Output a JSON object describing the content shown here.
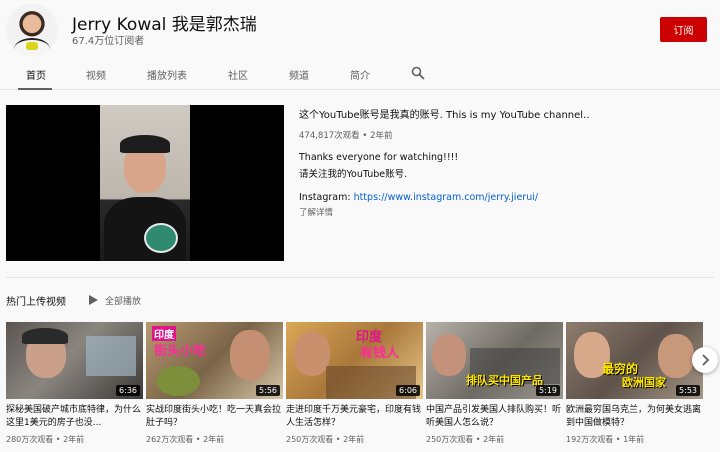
{
  "channel": {
    "name": "Jerry Kowal 我是郭杰瑞",
    "subscribers": "67.4万位订阅者",
    "subscribe_label": "订阅"
  },
  "tabs": [
    {
      "label": "首页",
      "active": true
    },
    {
      "label": "视频",
      "active": false
    },
    {
      "label": "播放列表",
      "active": false
    },
    {
      "label": "社区",
      "active": false
    },
    {
      "label": "频道",
      "active": false
    },
    {
      "label": "简介",
      "active": false
    }
  ],
  "featured": {
    "title": "这个YouTube账号是我真的账号. This is my YouTube channel…",
    "meta": "474,817次观看 • 2年前",
    "desc_line1": "Thanks everyone for watching!!!!",
    "desc_line2": "请关注我的YouTube账号.",
    "instagram_label": "Instagram: ",
    "instagram_link": "https://www.instagram.com/jerry.jierui/",
    "more_label": "了解详情"
  },
  "section": {
    "title": "热门上传视频",
    "play_all": "全部播放"
  },
  "videos": [
    {
      "title": "探秘美国破产城市底特律，为什么这里1美元的房子也没...",
      "meta": "280万次观看 • 2年前",
      "duration": "6:36",
      "overlay": "",
      "thumb_color": "#6b6560"
    },
    {
      "title": "实战印度街头小吃！吃一天真会拉肚子吗？",
      "meta": "262万次观看 • 2年前",
      "duration": "5:56",
      "overlay": "街头小吃",
      "overlay_top": "印度",
      "thumb_color": "#9a7f5c"
    },
    {
      "title": "走进印度千万美元豪宅，印度有钱人生活怎样？",
      "meta": "250万次观看 • 2年前",
      "duration": "6:06",
      "overlay": "有钱人",
      "overlay_top": "印度",
      "thumb_color": "#c79a45"
    },
    {
      "title": "中国产品引发美国人排队购买！听听美国人怎么说？",
      "meta": "250万次观看 • 2年前",
      "duration": "5:19",
      "overlay": "排队买中国产品",
      "thumb_color": "#8e8a84"
    },
    {
      "title": "欧洲最穷国乌克兰，为何美女逃离到中国做模特？",
      "meta": "192万次观看 • 1年前",
      "duration": "5:53",
      "overlay": "欧洲国家",
      "overlay_top": "最穷的",
      "thumb_color": "#7a6a5e"
    }
  ],
  "icons": {
    "search": "search-icon",
    "play_all": "play-icon",
    "next": "chevron-right-icon"
  },
  "colors": {
    "subscribe": "#cc0000",
    "link": "#065fd4"
  }
}
